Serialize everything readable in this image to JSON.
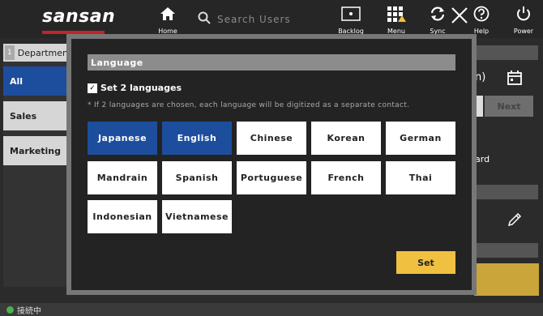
{
  "header": {
    "logo": "sansan",
    "search_placeholder": "Search Users",
    "nav": [
      {
        "label": "Home",
        "icon": "home-icon"
      },
      {
        "label": "Backlog",
        "icon": "backlog-icon"
      },
      {
        "label": "Menu",
        "icon": "grid-warning-icon"
      },
      {
        "label": "Sync",
        "icon": "sync-icon"
      },
      {
        "label": "Help",
        "icon": "help-icon"
      },
      {
        "label": "Power",
        "icon": "power-icon"
      }
    ]
  },
  "sidebar": {
    "department_number": "1",
    "department_label": "Departmen",
    "items": [
      {
        "label": "All",
        "active": true
      },
      {
        "label": "Sales",
        "active": false
      },
      {
        "label": "Marketing",
        "active": false
      }
    ]
  },
  "background_panel": {
    "partial_paren": "n)",
    "next_label": "Next",
    "partial_card": "ard"
  },
  "status": {
    "text": "接続中"
  },
  "modal": {
    "title": "Language",
    "checkbox_label": "Set 2 languages",
    "checkbox_checked": true,
    "hint": "* If 2 languages are chosen, each language will be digitized as a separate contact.",
    "languages": [
      {
        "label": "Japanese",
        "selected": true
      },
      {
        "label": "English",
        "selected": true
      },
      {
        "label": "Chinese",
        "selected": false
      },
      {
        "label": "Korean",
        "selected": false
      },
      {
        "label": "German",
        "selected": false
      },
      {
        "label": "Mandrain",
        "selected": false
      },
      {
        "label": "Spanish",
        "selected": false
      },
      {
        "label": "Portuguese",
        "selected": false
      },
      {
        "label": "French",
        "selected": false
      },
      {
        "label": "Thai",
        "selected": false
      },
      {
        "label": "Indonesian",
        "selected": false
      },
      {
        "label": "Vietnamese",
        "selected": false
      }
    ],
    "set_label": "Set"
  },
  "colors": {
    "selected": "#1d4e9e",
    "accent_yellow": "#f0c040",
    "brand_red": "#c0252a",
    "status_green": "#4caf50"
  }
}
